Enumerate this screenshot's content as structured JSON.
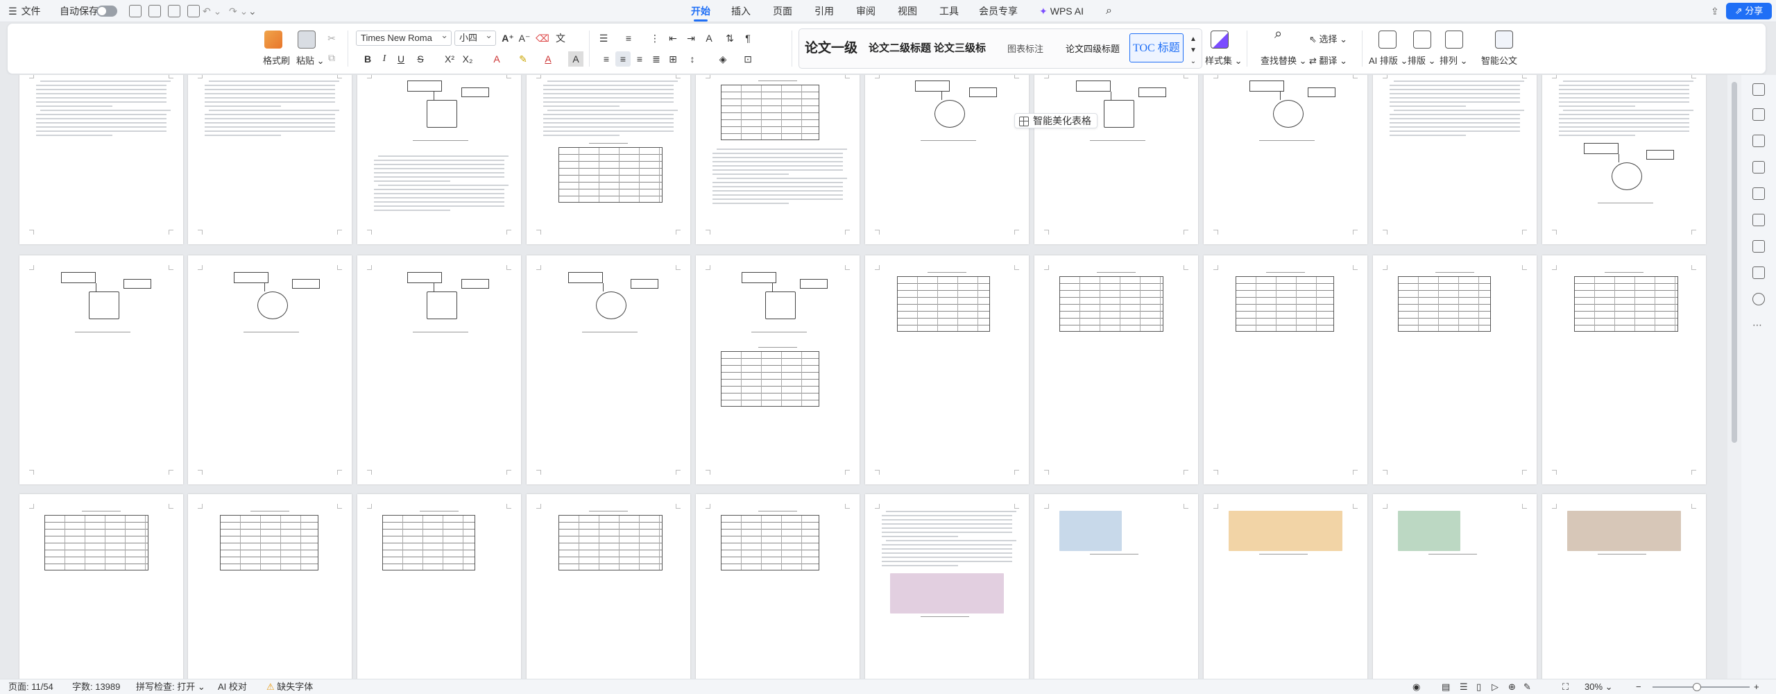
{
  "titlebar": {
    "file_menu": "文件",
    "autosave": "自动保存",
    "tabs": [
      {
        "label": "开始",
        "active": true
      },
      {
        "label": "插入"
      },
      {
        "label": "页面"
      },
      {
        "label": "引用"
      },
      {
        "label": "审阅"
      },
      {
        "label": "视图"
      },
      {
        "label": "工具"
      },
      {
        "label": "会员专享"
      },
      {
        "label": "WPS AI"
      }
    ],
    "share": "分享"
  },
  "ribbon": {
    "format_painter": "格式刷",
    "paste": "粘贴",
    "font_name": "Times New Roma",
    "font_size": "小四",
    "styles": [
      "论文一级",
      "论文二级标题",
      "论文三级标",
      "图表标注",
      "论文四级标题",
      "TOC 标题"
    ],
    "style_set": "样式集",
    "find_replace": "查找替换",
    "select": "选择",
    "translate": "翻译",
    "ai_layout": "AI 排版",
    "layout": "排版",
    "arrange": "排列",
    "smart_doc": "智能公文"
  },
  "floating_tip": "智能美化表格",
  "status": {
    "page": "页面: 11/54",
    "words": "字数: 13989",
    "spellcheck": "拼写检查: 打开",
    "ai_check": "AI 校对",
    "missing_font": "缺失字体",
    "zoom": "30%"
  },
  "colors": {
    "accent": "#1f6ff6",
    "workspace": "#e7e9ec"
  }
}
